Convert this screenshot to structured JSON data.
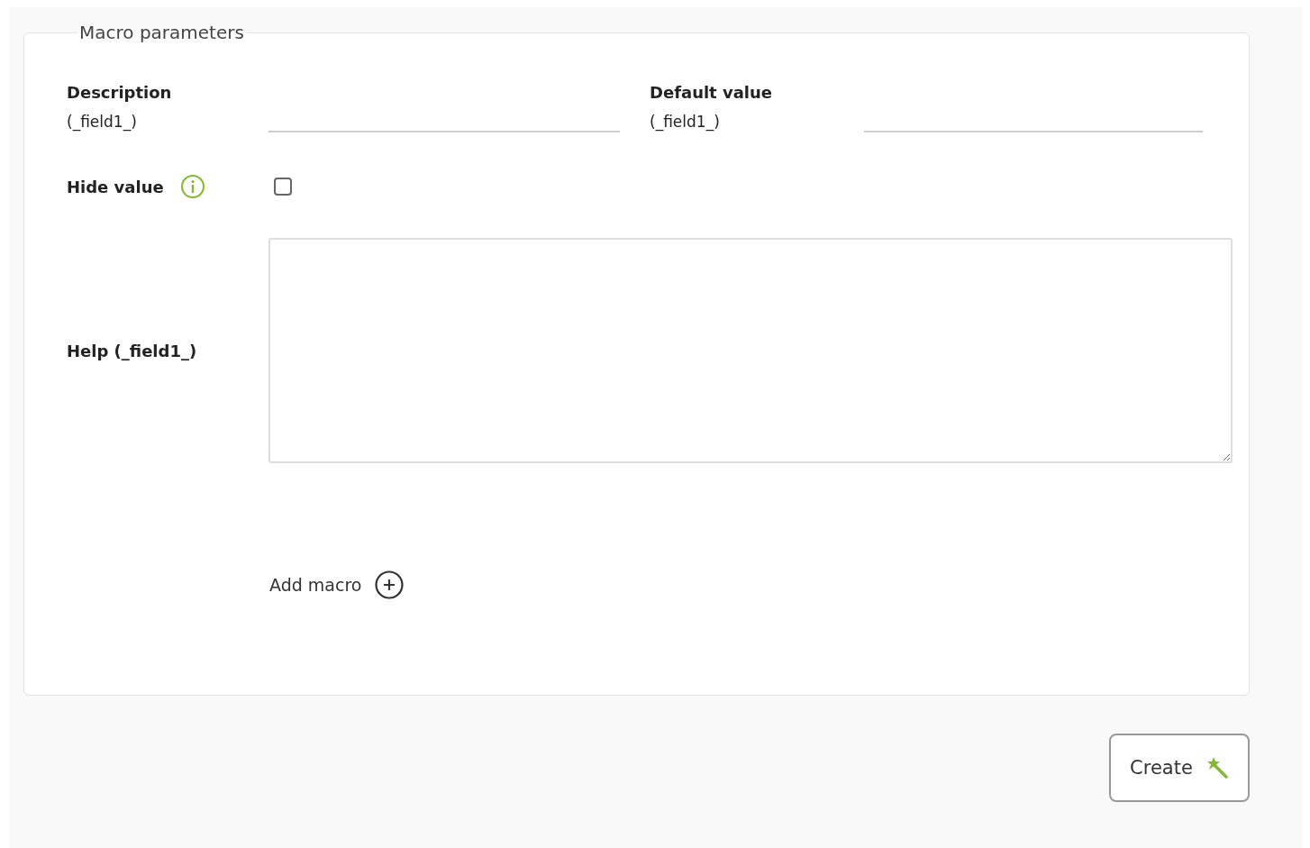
{
  "fieldset": {
    "legend": "Macro parameters"
  },
  "description": {
    "label": "Description",
    "field_label": "(_field1_)"
  },
  "default_value": {
    "label": "Default value",
    "field_label": "(_field1_)"
  },
  "hide_value": {
    "label": "Hide value",
    "checked": false
  },
  "help": {
    "label": "Help (_field1_)"
  },
  "add_macro": {
    "label": "Add macro"
  },
  "create_button": {
    "label": "Create"
  }
}
